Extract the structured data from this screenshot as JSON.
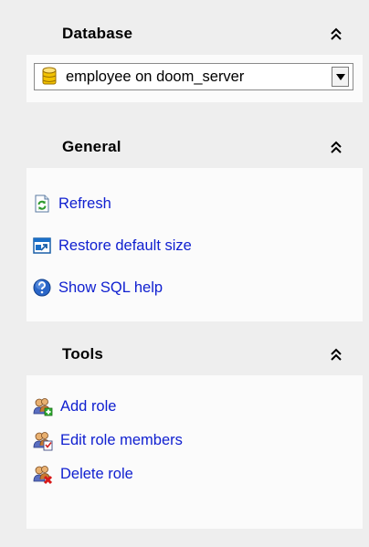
{
  "database": {
    "title": "Database",
    "selected": "employee on doom_server"
  },
  "general": {
    "title": "General",
    "links": [
      {
        "label": "Refresh",
        "icon": "refresh-icon"
      },
      {
        "label": "Restore default size",
        "icon": "restore-size-icon"
      },
      {
        "label": "Show SQL help",
        "icon": "help-icon"
      }
    ]
  },
  "tools": {
    "title": "Tools",
    "links": [
      {
        "label": "Add role",
        "icon": "add-role-icon"
      },
      {
        "label": "Edit role members",
        "icon": "edit-role-members-icon"
      },
      {
        "label": "Delete role",
        "icon": "delete-role-icon"
      }
    ]
  },
  "colors": {
    "link": "#1020d0",
    "panel_bg": "#fbfbfb",
    "sidebar_bg": "#eeeeee"
  }
}
